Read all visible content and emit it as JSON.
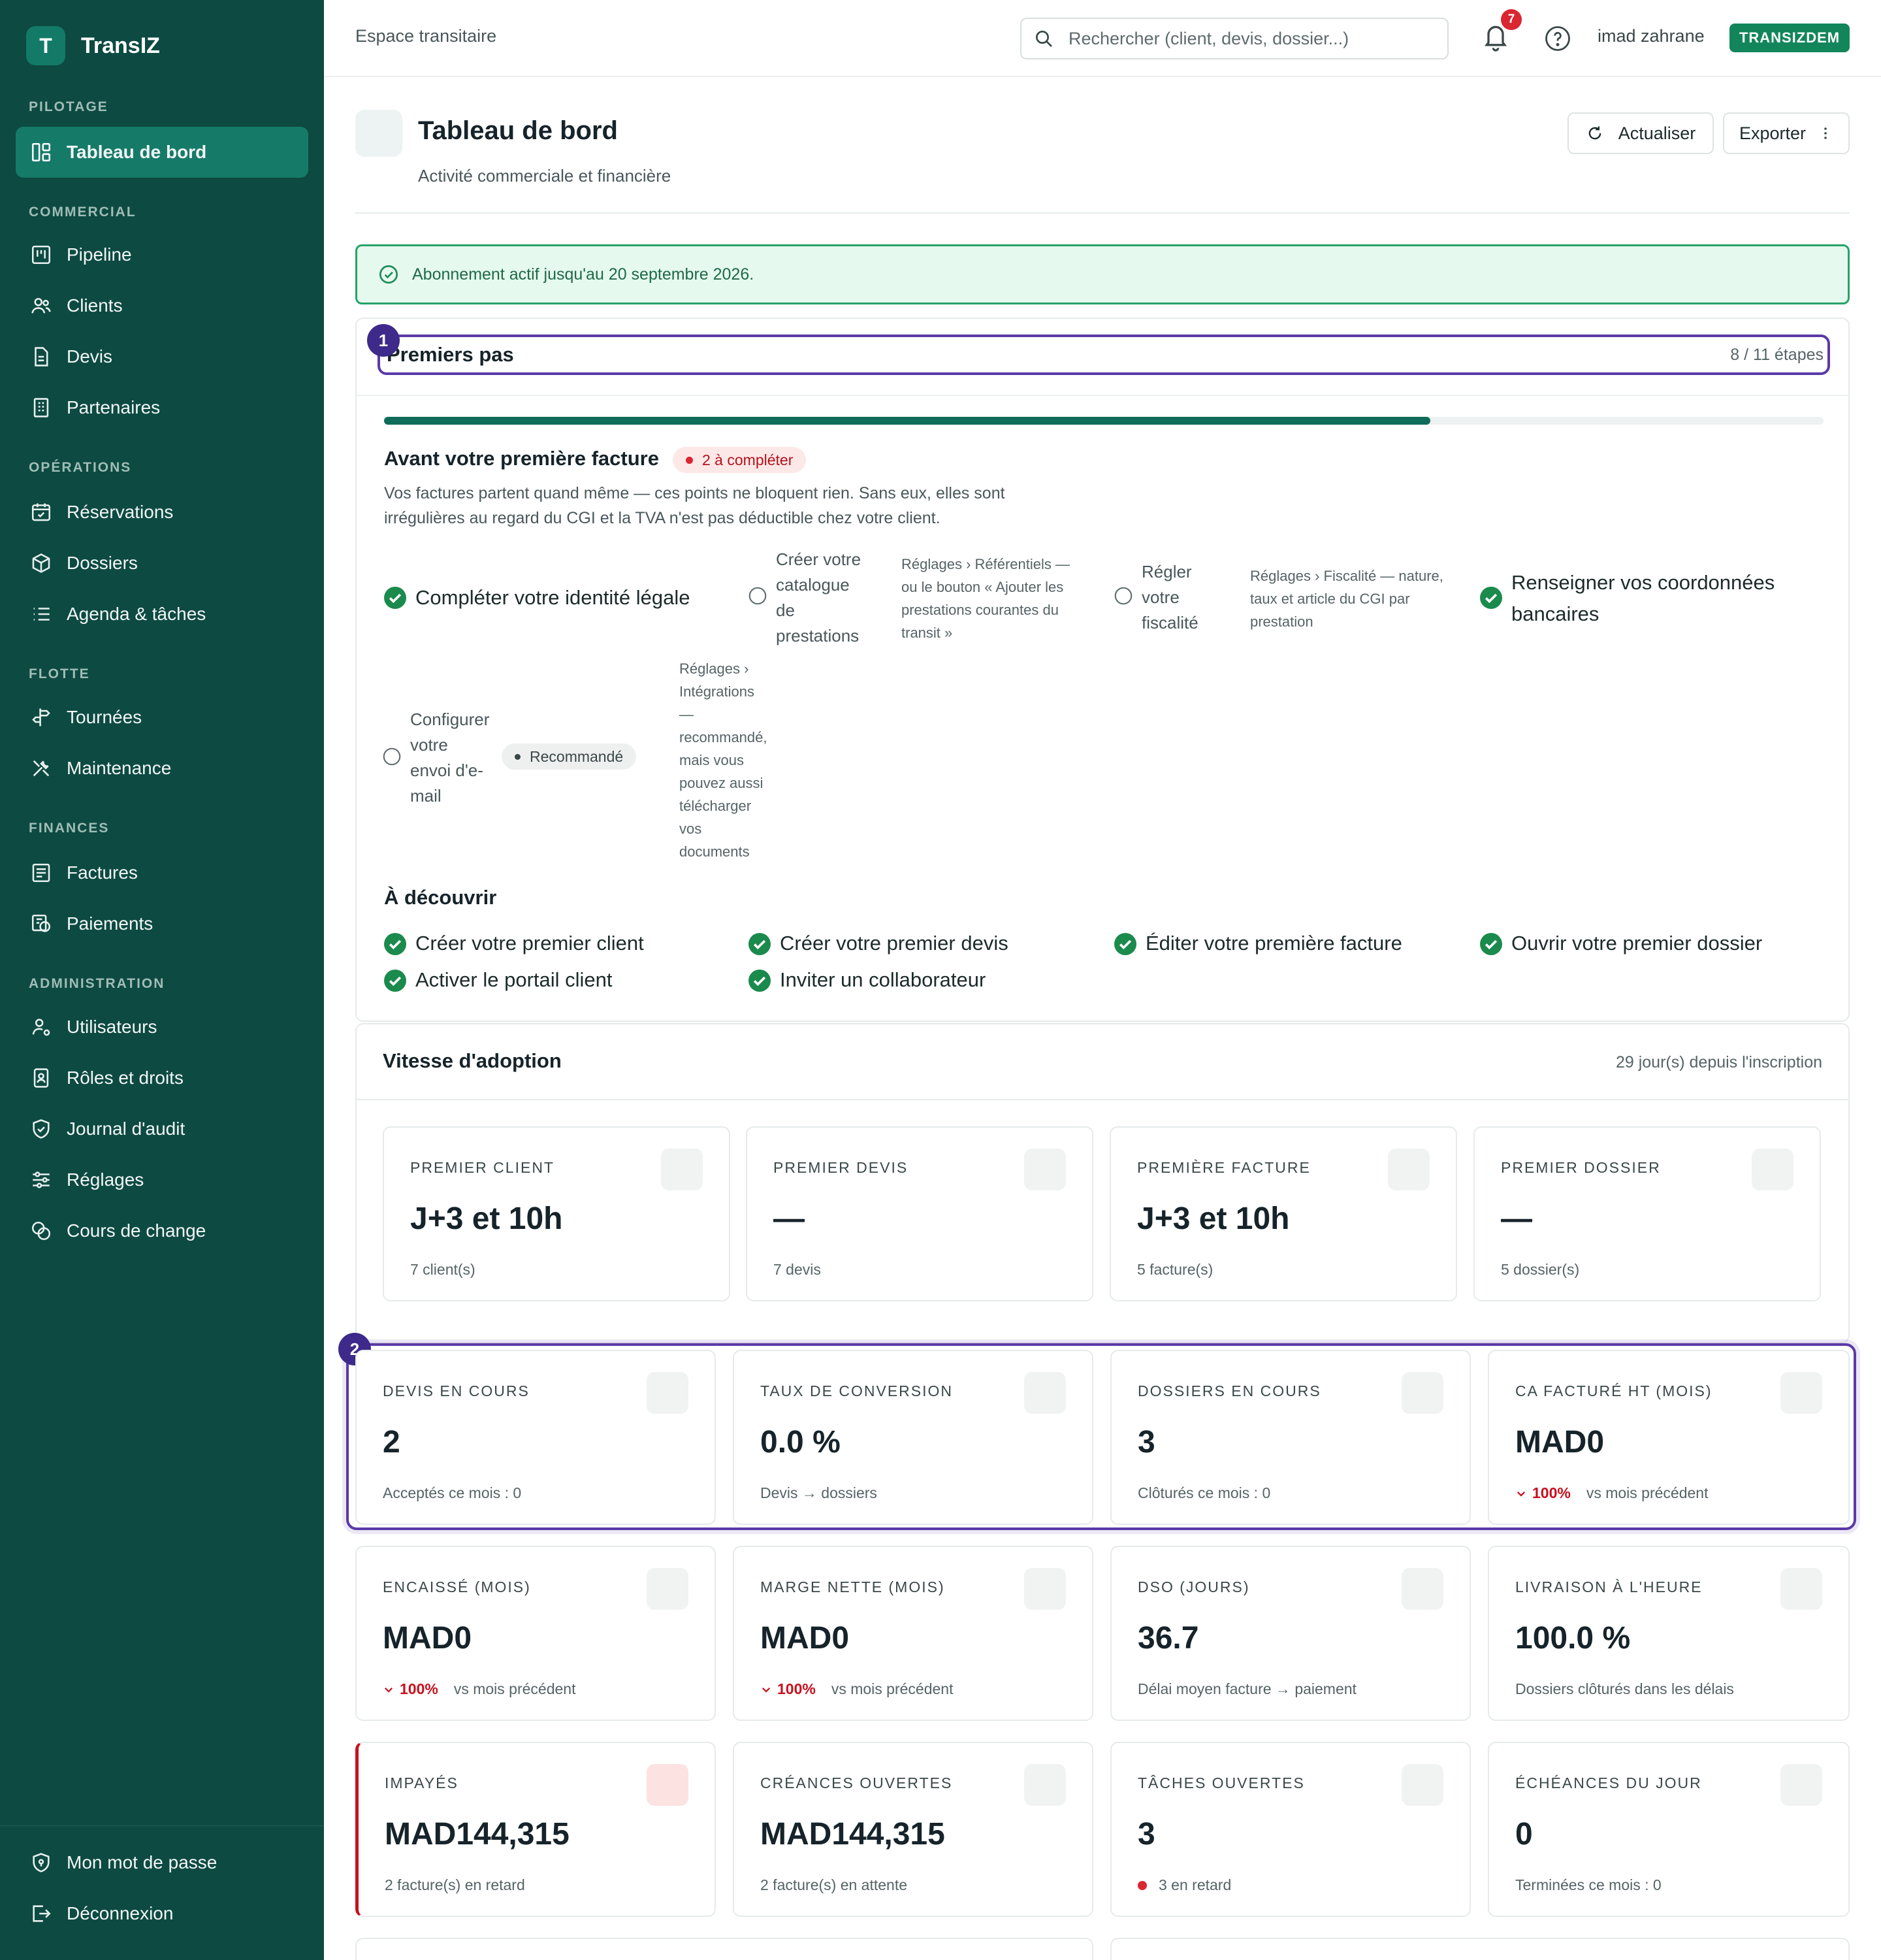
{
  "app": {
    "logo_letter": "T",
    "name": "TransIZ"
  },
  "sidebar": {
    "sections": {
      "pilotage": "PILOTAGE",
      "commercial": "COMMERCIAL",
      "operations": "OPÉRATIONS",
      "flotte": "FLOTTE",
      "finances": "FINANCES",
      "administration": "ADMINISTRATION"
    },
    "items": [
      {
        "label": "Tableau de bord",
        "icon": "dashboard-icon",
        "active": true
      },
      {
        "label": "Pipeline",
        "icon": "kanban-icon"
      },
      {
        "label": "Clients",
        "icon": "users-icon"
      },
      {
        "label": "Devis",
        "icon": "file-icon"
      },
      {
        "label": "Partenaires",
        "icon": "building-icon"
      },
      {
        "label": "Réservations",
        "icon": "calendar-check-icon"
      },
      {
        "label": "Dossiers",
        "icon": "package-icon"
      },
      {
        "label": "Agenda & tâches",
        "icon": "list-icon"
      },
      {
        "label": "Tournées",
        "icon": "signpost-icon"
      },
      {
        "label": "Maintenance",
        "icon": "tools-icon"
      },
      {
        "label": "Factures",
        "icon": "receipt-icon"
      },
      {
        "label": "Paiements",
        "icon": "payment-icon"
      },
      {
        "label": "Utilisateurs",
        "icon": "user-cog-icon"
      },
      {
        "label": "Rôles et droits",
        "icon": "id-badge-icon"
      },
      {
        "label": "Journal d'audit",
        "icon": "shield-check-icon"
      },
      {
        "label": "Réglages",
        "icon": "sliders-icon"
      },
      {
        "label": "Cours de change",
        "icon": "coins-icon"
      }
    ],
    "footer": [
      {
        "label": "Mon mot de passe",
        "icon": "shield-lock-icon"
      },
      {
        "label": "Déconnexion",
        "icon": "logout-icon"
      }
    ]
  },
  "topbar": {
    "workspace": "Espace transitaire",
    "search_placeholder": "Rechercher (client, devis, dossier...)",
    "notifications_count": "7",
    "user_name": "imad zahrane",
    "tenant": "TRANSIZDEM"
  },
  "page": {
    "title": "Tableau de bord",
    "subtitle": "Activité commerciale et financière",
    "refresh_label": "Actualiser",
    "export_label": "Exporter"
  },
  "subscription_alert": "Abonnement actif jusqu'au 20 septembre 2026.",
  "onboarding": {
    "marker": "1",
    "title": "Premiers pas",
    "steps_text": "8 / 11 étapes",
    "progress": 0.727,
    "section_title": "Avant votre première facture",
    "pending_badge": "2 à compléter",
    "description_line1": "Vos factures partent quand même — ces points ne bloquent rien. Sans eux, elles sont",
    "description_line2": "irrégulières au regard du CGI et la TVA n'est pas déductible chez votre client.",
    "steps": {
      "identity": "Compléter votre identité légale",
      "catalogue": [
        "Créer votre",
        "catalogue",
        "de",
        "prestations"
      ],
      "catalogue_hint": [
        "Réglages › Référentiels —",
        "ou le bouton « Ajouter les",
        "prestations courantes du",
        "transit »"
      ],
      "fiscal": [
        "Régler",
        "votre",
        "fiscalité"
      ],
      "fiscal_hint": [
        "Réglages › Fiscalité — nature,",
        "taux et article du CGI par",
        "prestation"
      ],
      "bank": [
        "Renseigner vos coordonnées",
        "bancaires"
      ],
      "email": [
        "Configurer",
        "votre",
        "envoi d'e-",
        "mail"
      ],
      "recommended": "Recommandé",
      "email_hint": [
        "Réglages ›",
        "Intégrations",
        "—",
        "recommandé,",
        "mais vous",
        "pouvez aussi",
        "télécharger",
        "vos",
        "documents"
      ]
    },
    "discover_title": "À découvrir",
    "discover": [
      "Créer votre premier client",
      "Créer votre premier devis",
      "Éditer votre première facture",
      "Ouvrir votre premier dossier",
      "Activer le portail client",
      "Inviter un collaborateur"
    ]
  },
  "adoption": {
    "title": "Vitesse d'adoption",
    "meta": "29 jour(s) depuis l'inscription",
    "cards": [
      {
        "label": "PREMIER CLIENT",
        "value": "J+3 et 10h",
        "sub": "7 client(s)"
      },
      {
        "label": "PREMIER DEVIS",
        "value": "—",
        "sub": "7 devis"
      },
      {
        "label": "PREMIÈRE FACTURE",
        "value": "J+3 et 10h",
        "sub": "5 facture(s)"
      },
      {
        "label": "PREMIER DOSSIER",
        "value": "—",
        "sub": "5 dossier(s)"
      }
    ]
  },
  "kpis": {
    "marker": "2",
    "row1": [
      {
        "label": "DEVIS EN COURS",
        "value": "2",
        "sub": "Acceptés ce mois : 0"
      },
      {
        "label": "TAUX DE CONVERSION",
        "value": "0.0 %",
        "sub": "Devis → dossiers"
      },
      {
        "label": "DOSSIERS EN COURS",
        "value": "3",
        "sub": "Clôturés ce mois : 0"
      },
      {
        "label": "CA FACTURÉ HT (MOIS)",
        "value": "MAD0",
        "trend": "100%",
        "sub": "vs mois précédent"
      }
    ],
    "row2": [
      {
        "label": "ENCAISSÉ (MOIS)",
        "value": "MAD0",
        "trend": "100%",
        "sub": "vs mois précédent"
      },
      {
        "label": "MARGE NETTE (MOIS)",
        "value": "MAD0",
        "trend": "100%",
        "sub": "vs mois précédent"
      },
      {
        "label": "DSO (JOURS)",
        "value": "36.7",
        "sub": "Délai moyen facture → paiement"
      },
      {
        "label": "LIVRAISON À L'HEURE",
        "value": "100.0 %",
        "sub": "Dossiers clôturés dans les délais"
      }
    ],
    "row3": [
      {
        "label": "IMPAYÉS",
        "value": "MAD144,315",
        "sub": "2 facture(s) en retard"
      },
      {
        "label": "CRÉANCES OUVERTES",
        "value": "MAD144,315",
        "sub": "2 facture(s) en attente"
      },
      {
        "label": "TÂCHES OUVERTES",
        "value": "3",
        "sub": "3 en retard"
      },
      {
        "label": "ÉCHÉANCES DU JOUR",
        "value": "0",
        "sub": "Terminées ce mois : 0"
      }
    ]
  },
  "colors": {
    "sidebar_bg": "#0d4a42",
    "accent": "#0f6b5a",
    "success": "#12865a",
    "danger": "#c8101e",
    "highlight": "#5a3aa8"
  }
}
